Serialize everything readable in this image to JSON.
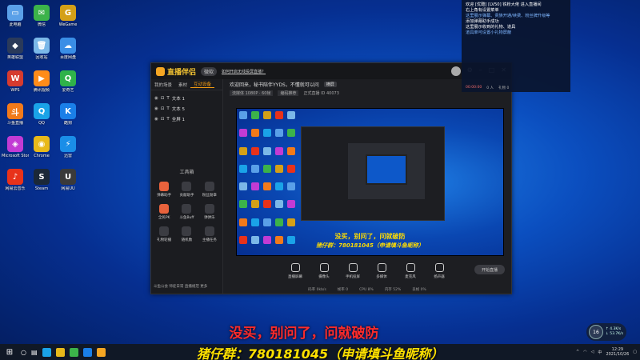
{
  "desktop": {
    "icons": [
      {
        "label": "此电脑",
        "color": "#5aa0e8",
        "glyph": "▭"
      },
      {
        "label": "微信",
        "color": "#3cb34a",
        "glyph": "✉"
      },
      {
        "label": "WeGame",
        "color": "#d4a017",
        "glyph": "G"
      },
      {
        "label": "英雄联盟",
        "color": "#2a3a5a",
        "glyph": "◆"
      },
      {
        "label": "回收站",
        "color": "#7bb8e8",
        "glyph": "🗑"
      },
      {
        "label": "百度网盘",
        "color": "#3a8ee6",
        "glyph": "☁"
      },
      {
        "label": "WPS",
        "color": "#d63b2f",
        "glyph": "W"
      },
      {
        "label": "腾讯视频",
        "color": "#ff8c1a",
        "glyph": "▶"
      },
      {
        "label": "爱奇艺",
        "color": "#2fb24a",
        "glyph": "Q"
      },
      {
        "label": "斗鱼直播",
        "color": "#f27a1a",
        "glyph": "斗"
      },
      {
        "label": "QQ",
        "color": "#1aa3e8",
        "glyph": "Q"
      },
      {
        "label": "酷狗",
        "color": "#1a7fe8",
        "glyph": "K"
      },
      {
        "label": "Microsoft Store",
        "color": "#c23bd4",
        "glyph": "◈"
      },
      {
        "label": "Chrome",
        "color": "#e8b91a",
        "glyph": "◉"
      },
      {
        "label": "迅雷",
        "color": "#1a8ee8",
        "glyph": "⚡"
      },
      {
        "label": "网易云音乐",
        "color": "#e8321a",
        "glyph": "♪"
      },
      {
        "label": "Steam",
        "color": "#1b2838",
        "glyph": "S"
      },
      {
        "label": "网易UU",
        "color": "#3a3a3a",
        "glyph": "U"
      }
    ]
  },
  "app": {
    "brand": "直播伴侣",
    "badge": "微软",
    "title_link": "如何开启无线投屏直播？",
    "tabs": [
      "我的场景",
      "素材",
      "互动设备"
    ],
    "scenes": [
      {
        "label": "文本 1"
      },
      {
        "label": "文本 5"
      },
      {
        "label": "全屏 1"
      }
    ],
    "tool_title": "工具箱",
    "tools": [
      {
        "label": "弹幕助手",
        "highlight": true
      },
      {
        "label": "贡献助手",
        "highlight": false
      },
      {
        "label": "粉丝勋章",
        "highlight": false
      },
      {
        "label": "全民PK",
        "highlight": true
      },
      {
        "label": "斗鱼Buff",
        "highlight": false
      },
      {
        "label": "弹弹乐",
        "highlight": false
      },
      {
        "label": "礼物轮播",
        "highlight": false
      },
      {
        "label": "随机数",
        "highlight": false
      },
      {
        "label": "主播任务",
        "highlight": false
      }
    ],
    "left_footer": "斗鱼公会   师徒日常   直播规范   更多",
    "notice_text": "欢迎回来，秘书陪伴YYDS，不懂就可以问",
    "notice_btn": "横屏",
    "info_chip1": "流媒体 1080P · 60帧",
    "info_chip2": "编码推荐",
    "info_text": "正式直播   ID 40073",
    "preview_line1": "没买，别问了，问就破防",
    "preview_line2": "猪仔群：780181045（申请填斗鱼昵称）",
    "bottom_tools": [
      {
        "label": "直播屏幕"
      },
      {
        "label": "摄像头"
      },
      {
        "label": "手机投屏"
      },
      {
        "label": "多媒体"
      },
      {
        "label": "麦克风"
      },
      {
        "label": "扬声器"
      }
    ],
    "go_live": "开始直播",
    "status_items": [
      "码率 0kb/s",
      "帧率 0",
      "CPU 8%",
      "内存 52%",
      "丢帧 0%"
    ]
  },
  "danmu": {
    "lines": [
      {
        "text": "欢迎 [优酷] [LV50] 铁粉大佬 进入直播间",
        "hl": false
      },
      {
        "text": "右上角有设置菜单",
        "hl": false
      },
      {
        "text": "这里展示弹幕、贵族开通/续费、粉丝牌升级等",
        "hl": true
      },
      {
        "text": "添加弹幕助手成功",
        "hl": false
      },
      {
        "text": "这里展示收到的礼物、道具",
        "hl": false
      },
      {
        "text": "道具单可设置小礼物屏蔽",
        "hl": true
      }
    ],
    "footer": [
      "00:00:00",
      "0 人",
      "礼物 0"
    ]
  },
  "caption_main": "没买，别问了，问就破防",
  "caption_group": "猪仔群：780181045（申请填斗鱼昵称）",
  "speed_widget": {
    "percent": "16",
    "up": "4.3K/s",
    "down": "53.7K/s"
  },
  "taskbar": {
    "time": "12:29",
    "date": "2021/10/26",
    "lang": "中"
  }
}
